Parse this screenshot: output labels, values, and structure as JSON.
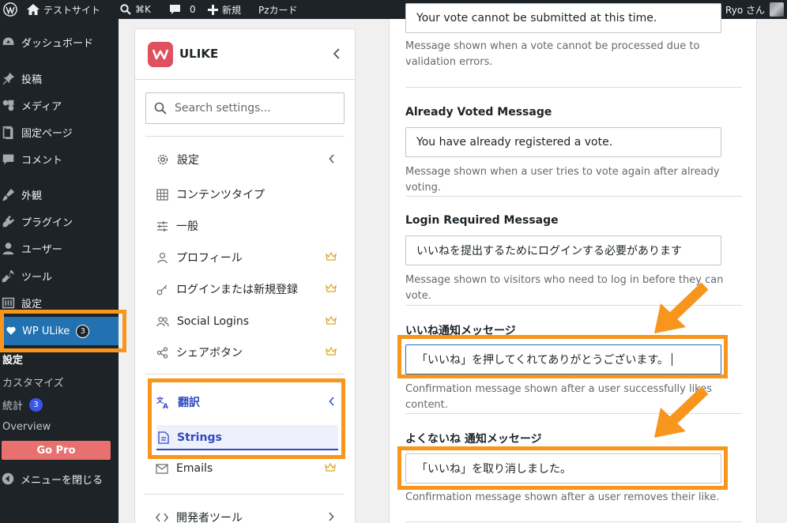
{
  "adminbar": {
    "site_name": "テストサイト",
    "search_shortcut": "⌘K",
    "comments_count": "0",
    "new_label": "新規",
    "pz_label": "Pzカード",
    "greeting": "こんにちは、Ryo さん"
  },
  "adminmenu": {
    "items": [
      {
        "label": "ダッシュボード",
        "icon": "dashboard-icon"
      },
      {
        "label": "投稿",
        "icon": "pin-icon"
      },
      {
        "label": "メディア",
        "icon": "media-icon"
      },
      {
        "label": "固定ページ",
        "icon": "page-icon"
      },
      {
        "label": "コメント",
        "icon": "comment-icon"
      },
      {
        "label": "外観",
        "icon": "brush-icon"
      },
      {
        "label": "プラグイン",
        "icon": "plugin-icon"
      },
      {
        "label": "ユーザー",
        "icon": "user-icon"
      },
      {
        "label": "ツール",
        "icon": "wrench-icon"
      },
      {
        "label": "設定",
        "icon": "settings-icon"
      }
    ],
    "active": {
      "label": "WP ULike",
      "badge": "3",
      "icon": "heart-icon"
    },
    "submenu": {
      "head": "設定",
      "customize": "カスタマイズ",
      "stats": "統計",
      "stats_badge": "3",
      "overview": "Overview",
      "gopro": "Go Pro"
    },
    "collapse": "メニューを閉じる"
  },
  "ulike": {
    "logo": "ULIKE",
    "search_placeholder": "Search settings...",
    "nav": {
      "settings": "設定",
      "content_types": "コンテンツタイプ",
      "general": "一般",
      "profile": "プロフィール",
      "login": "ログインまたは新規登録",
      "social": "Social Logins",
      "share": "シェアボタン",
      "translate": "翻訳",
      "strings": "Strings",
      "emails": "Emails",
      "developer": "開発者ツール"
    }
  },
  "main": {
    "top_input_value": "Your vote cannot be submitted at this time.",
    "top_help": "Message shown when a vote cannot be processed due to validation errors.",
    "fields": [
      {
        "label": "Already Voted Message",
        "value": "You have already registered a vote.",
        "help": "Message shown when a user tries to vote again after already voting."
      },
      {
        "label": "Login Required Message",
        "value": "いいねを提出するためにログインする必要があります",
        "help": "Message shown to visitors who need to log in before they can vote."
      },
      {
        "label": "いいね通知メッセージ",
        "value": "「いいね」を押してくれてありがとうございます。",
        "help": "Confirmation message shown after a user successfully likes content."
      },
      {
        "label": "よくないね 通知メッセージ",
        "value": "「いいね」を取り消しました。",
        "help": "Confirmation message shown after a user removes their like."
      }
    ]
  },
  "colors": {
    "highlight": "#f7951d",
    "accent": "#2f48c5",
    "wp_active": "#2271b1",
    "gopro": "#e8706f"
  }
}
